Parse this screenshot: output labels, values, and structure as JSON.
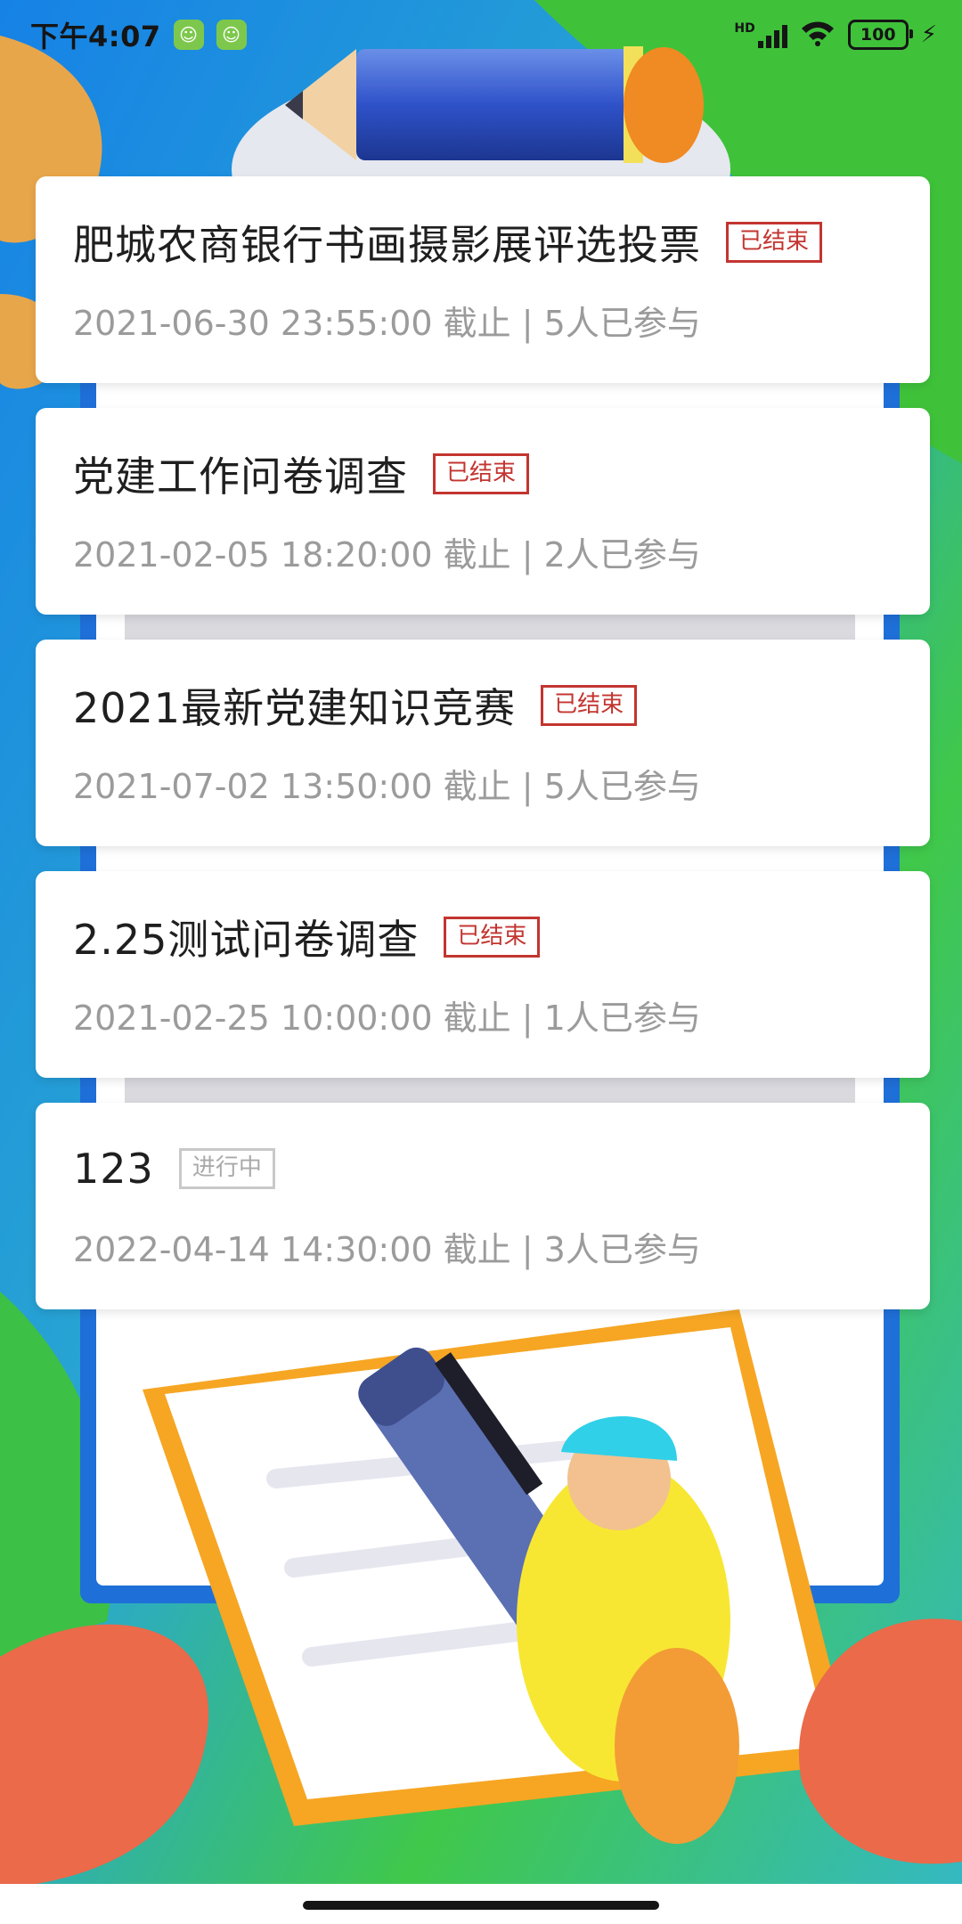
{
  "status_bar": {
    "time": "下午4:07",
    "app_icons": [
      "app-notification-icon",
      "app-notification-icon"
    ],
    "signal": "HD",
    "battery": "100"
  },
  "surveys": [
    {
      "title": "肥城农商银行书画摄影展评选投票",
      "status": "已结束",
      "deadline": "2021-06-30 23:55:00 截止",
      "separator": "|",
      "participants": "5人已参与"
    },
    {
      "title": "党建工作问卷调查",
      "status": "已结束",
      "deadline": "2021-02-05 18:20:00 截止",
      "separator": "|",
      "participants": "2人已参与"
    },
    {
      "title": "2021最新党建知识竞赛",
      "status": "已结束",
      "deadline": "2021-07-02 13:50:00 截止",
      "separator": "|",
      "participants": "5人已参与"
    },
    {
      "title": "2.25测试问卷调查",
      "status": "已结束",
      "deadline": "2021-02-25 10:00:00 截止",
      "separator": "|",
      "participants": "1人已参与"
    },
    {
      "title": "123",
      "status": "进行中",
      "deadline": "2022-04-14 14:30:00 截止",
      "separator": "|",
      "participants": "3人已参与"
    }
  ],
  "colors": {
    "ended_tag": "#c33530",
    "ongoing_tag": "#a9a9a9",
    "background_blue": "#1a7be0",
    "background_green": "#3fc23a"
  }
}
